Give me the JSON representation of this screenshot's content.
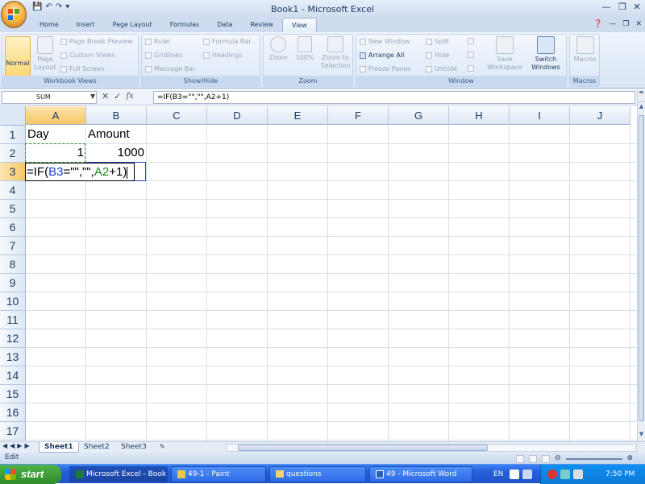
{
  "window": {
    "title": "Book1 - Microsoft Excel"
  },
  "qat": {
    "icons": [
      "save-icon",
      "undo-icon",
      "redo-icon",
      "customize-icon"
    ]
  },
  "tabs": [
    "Home",
    "Insert",
    "Page Layout",
    "Formulas",
    "Data",
    "Review",
    "View"
  ],
  "active_tab": "View",
  "ribbon": {
    "workbook_views": {
      "label": "Workbook Views",
      "normal": "Normal",
      "page_layout": "Page Layout",
      "page_break_preview": "Page Break Preview",
      "custom_views": "Custom Views",
      "full_screen": "Full Screen"
    },
    "show_hide": {
      "label": "Show/Hide",
      "ruler": "Ruler",
      "formula_bar": "Formula Bar",
      "gridlines": "Gridlines",
      "headings": "Headings",
      "message_bar": "Message Bar"
    },
    "zoom": {
      "label": "Zoom",
      "zoom": "Zoom",
      "hundred": "100%",
      "zoom_to_selection": "Zoom to Selection"
    },
    "window": {
      "label": "Window",
      "new_window": "New Window",
      "arrange_all": "Arrange All",
      "freeze_panes": "Freeze Panes",
      "split": "Split",
      "hide": "Hide",
      "unhide": "Unhide",
      "save_workspace": "Save Workspace",
      "switch_windows": "Switch Windows"
    },
    "macros": {
      "label": "Macros",
      "macros": "Macros"
    }
  },
  "formula_bar": {
    "name_box": "SUM",
    "fx": "fx",
    "formula": "=IF(B3=\"\",\"\",A2+1)"
  },
  "columns": [
    "A",
    "B",
    "C",
    "D",
    "E",
    "F",
    "G",
    "H",
    "I",
    "J"
  ],
  "rows": [
    "1",
    "2",
    "3",
    "4",
    "5",
    "6",
    "7",
    "8",
    "9",
    "10",
    "11",
    "12",
    "13",
    "14",
    "15",
    "16",
    "17"
  ],
  "cells": {
    "A1": "Day",
    "B1": "Amount",
    "A2": "1",
    "B2": "1000",
    "A3_prefix": "=IF(",
    "A3_ref1": "B3",
    "A3_mid": "=\"\",\"\",",
    "A3_ref2": "A2",
    "A3_suffix": "+1)"
  },
  "colors": {
    "ref1": "#2040c0",
    "ref2": "#1a8a1a",
    "accent": "#f7c766"
  },
  "sheets": [
    "Sheet1",
    "Sheet2",
    "Sheet3"
  ],
  "active_sheet": "Sheet1",
  "status": {
    "mode": "Edit"
  },
  "taskbar": {
    "start": "start",
    "items": [
      "Microsoft Excel - Book1",
      "49-1 - Paint",
      "questions",
      "49 - Microsoft Word"
    ],
    "lang": "EN",
    "clock": "7:50 PM"
  }
}
